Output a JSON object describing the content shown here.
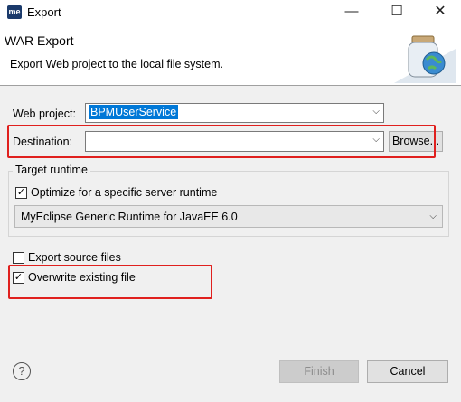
{
  "window": {
    "app_icon_text": "me",
    "title": "Export",
    "minimize_glyph": "—",
    "maximize_glyph": "☐",
    "close_glyph": "✕"
  },
  "header": {
    "title": "WAR Export",
    "description": "Export Web project to the local file system."
  },
  "form": {
    "web_project_label": "Web project:",
    "web_project_value": "BPMUserService",
    "destination_label": "Destination:",
    "destination_value": "",
    "browse_label": "Browse..."
  },
  "target_runtime": {
    "group_title": "Target runtime",
    "optimize_label": "Optimize for a specific server runtime",
    "optimize_checked": true,
    "runtime_value": "MyEclipse Generic Runtime for JavaEE 6.0"
  },
  "options": {
    "export_source_label": "Export source files",
    "export_source_checked": false,
    "overwrite_label": "Overwrite existing file",
    "overwrite_checked": true
  },
  "footer": {
    "help_glyph": "?",
    "finish_label": "Finish",
    "cancel_label": "Cancel"
  },
  "colors": {
    "highlight": "#e0201e",
    "selection": "#0078d7",
    "dialog_bg": "#f0f0f0"
  }
}
